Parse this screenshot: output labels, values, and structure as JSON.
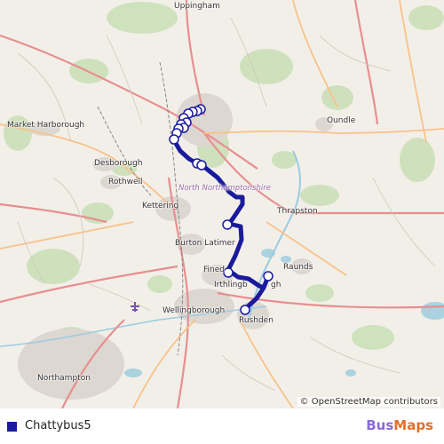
{
  "map": {
    "places": [
      {
        "id": "uppingham",
        "label": "Uppingham"
      },
      {
        "id": "market-harborough",
        "label": "Market Harborough"
      },
      {
        "id": "oundle",
        "label": "Oundle"
      },
      {
        "id": "desborough",
        "label": "Desborough"
      },
      {
        "id": "rothwell",
        "label": "Rothwell"
      },
      {
        "id": "north-northamptonshire",
        "label": "North Northamptonshire"
      },
      {
        "id": "kettering",
        "label": "Kettering"
      },
      {
        "id": "thrapston",
        "label": "Thrapston"
      },
      {
        "id": "burton-latimer",
        "label": "Burton Latimer"
      },
      {
        "id": "finedon",
        "label": "Fined"
      },
      {
        "id": "raunds",
        "label": "Raunds"
      },
      {
        "id": "irthlingborough",
        "label": "Irthlingb"
      },
      {
        "id": "irthlingborough-tail",
        "label": "gh"
      },
      {
        "id": "wellingborough",
        "label": "Wellingborough"
      },
      {
        "id": "rushden",
        "label": "Rushden"
      },
      {
        "id": "northampton",
        "label": "Northampton"
      }
    ],
    "attribution": "© OpenStreetMap contributors",
    "route_color": "#1a1a9c"
  },
  "legend": {
    "route_name": "Chattybus5",
    "route_color": "#1a1a9c"
  },
  "brand": {
    "part1": "Bus",
    "part2": "Maps"
  }
}
